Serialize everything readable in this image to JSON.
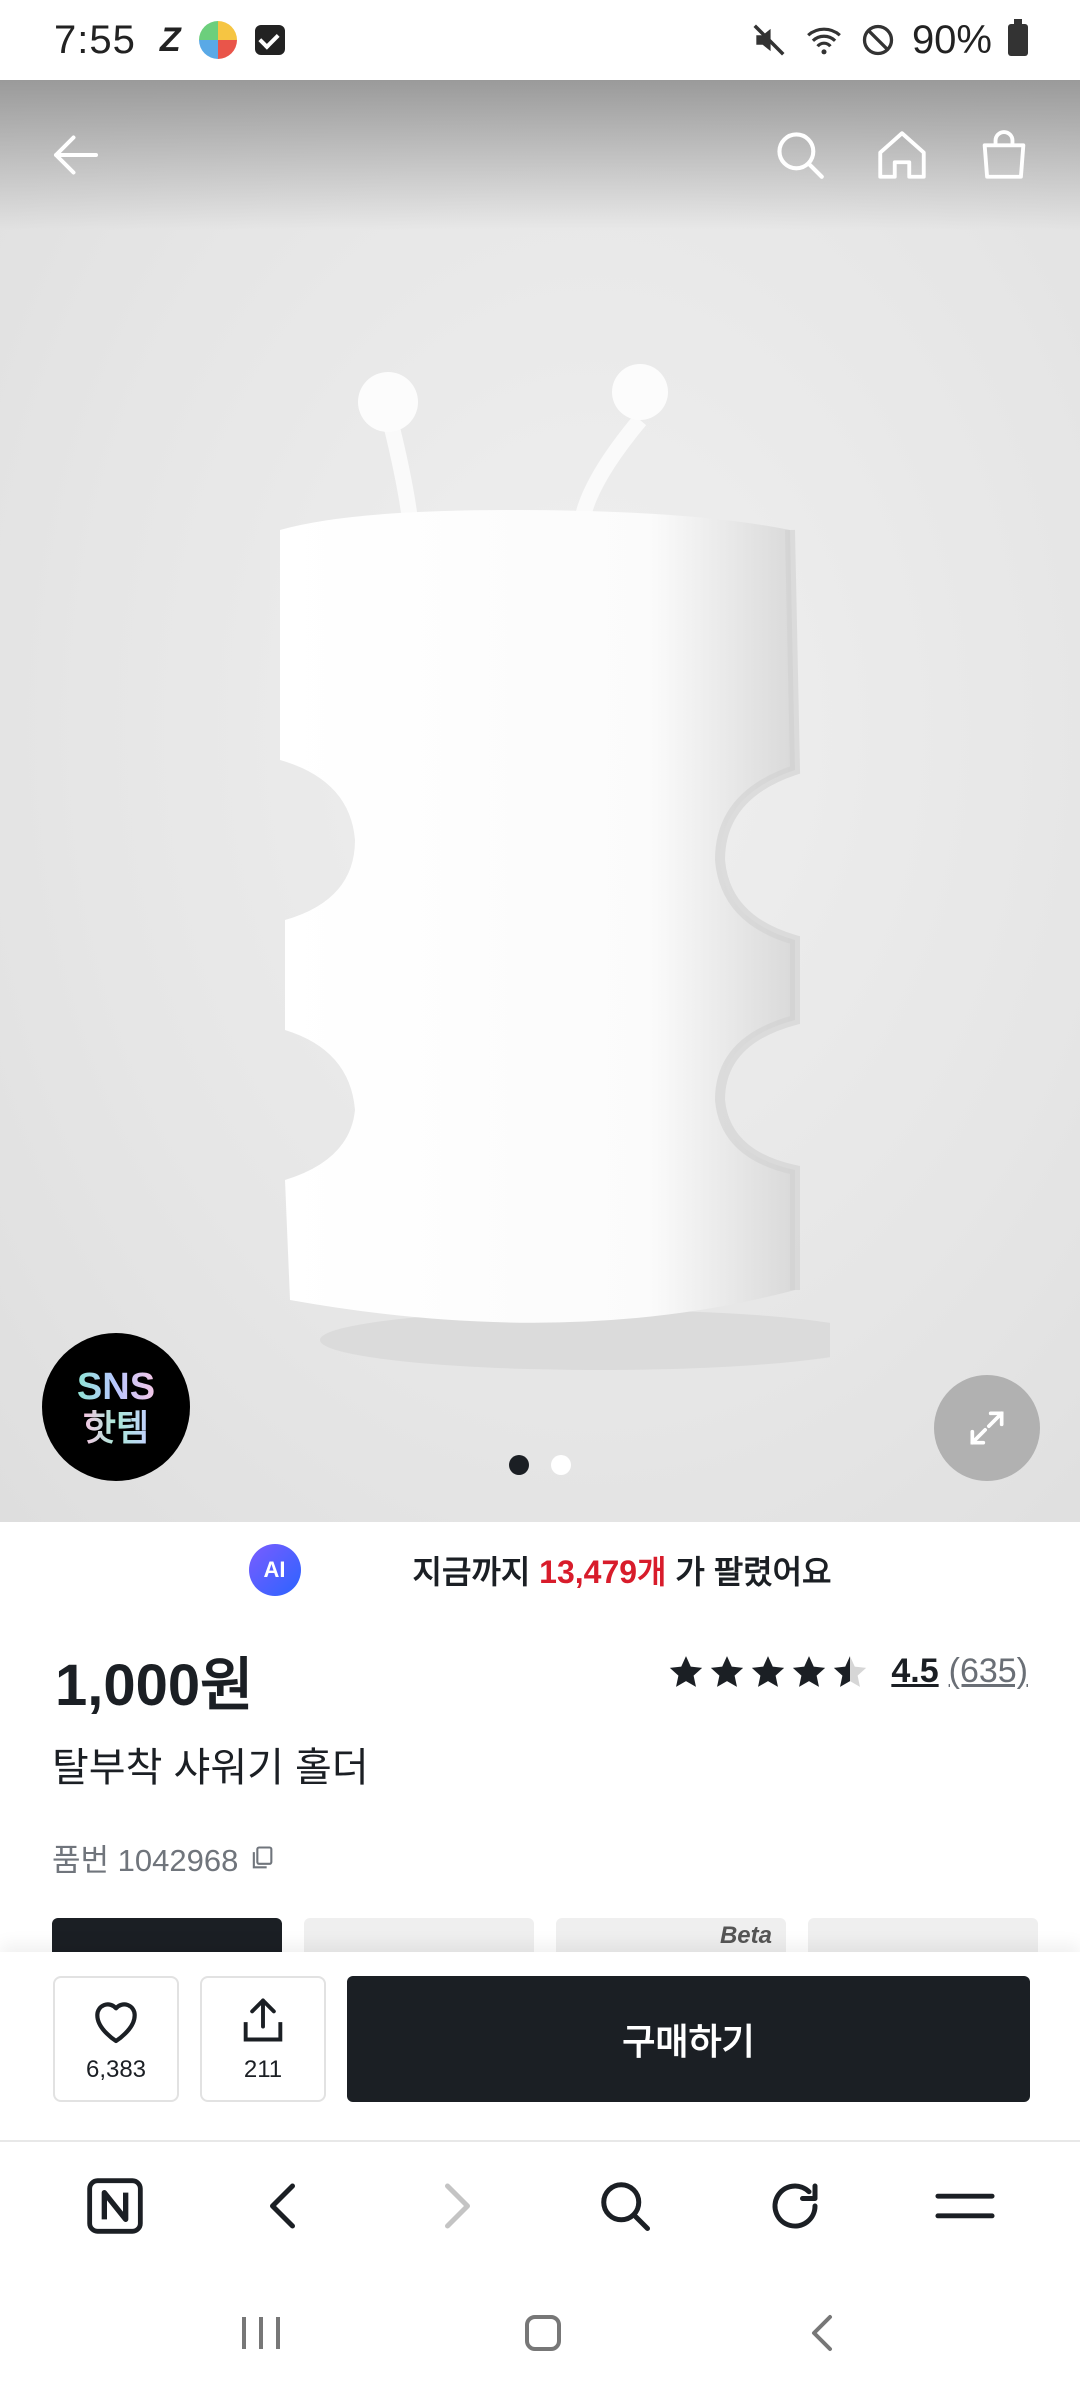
{
  "status_bar": {
    "time": "7:55",
    "battery": "90%"
  },
  "product_badge": {
    "line1": "SNS",
    "line2": "핫템"
  },
  "gallery": {
    "image_count": 2,
    "active_index": 0
  },
  "sold": {
    "ai_label": "AI",
    "prefix": "지금까지",
    "count": "13,479개",
    "suffix": "가 팔렸어요"
  },
  "product": {
    "price": "1,000원",
    "rating": {
      "score": "4.5",
      "count": "(635)",
      "stars_value": 4.5
    },
    "title": "탈부착 샤워기 홀더",
    "sku": "품번 1042968"
  },
  "thumbnail_tab_text": "Beta",
  "actions": {
    "like_count": "6,383",
    "share_count": "211",
    "buy_label": "구매하기"
  },
  "browser_toolbar": {
    "items": [
      "naver-icon",
      "back-icon",
      "forward-icon",
      "search-icon",
      "refresh-icon",
      "menu-icon"
    ]
  },
  "colors": {
    "accent_dark": "#1b1f24",
    "sold_red": "#d81c2b",
    "ai_gradient_start": "#7a5cff",
    "ai_gradient_end": "#2b64ff"
  }
}
